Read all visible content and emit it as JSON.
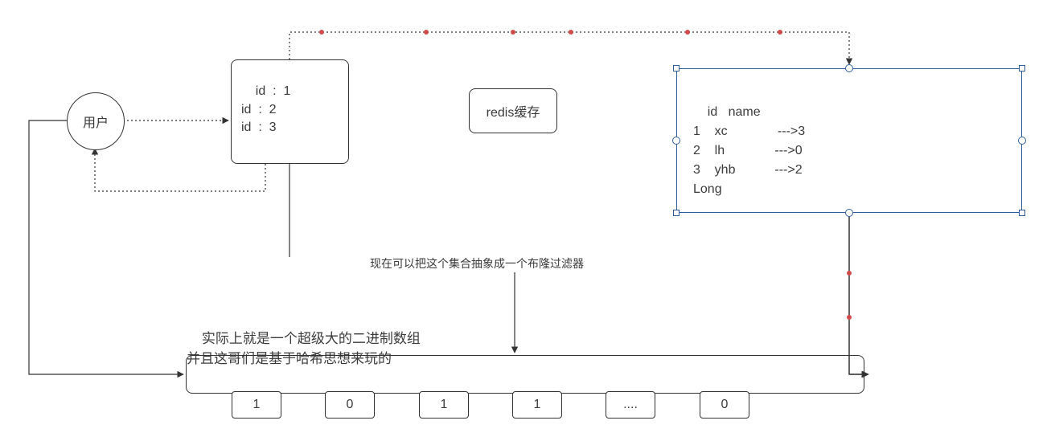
{
  "user": {
    "label": "用户"
  },
  "id_box": {
    "text": "id  :  1\nid  :  2\nid  :  3"
  },
  "redis": {
    "label": "redis缓存"
  },
  "db": {
    "text": "id   name\n1    xc              --->3\n2    lh              --->0\n3    yhb           --->2\nLong"
  },
  "annotation_top": "现在可以把这个集合抽象成一个布隆过滤器",
  "annotation_left": "实际上就是一个超级大的二进制数组\n并且这哥们是基于哈希思想来玩的",
  "cells": [
    "1",
    "0",
    "1",
    "1",
    "....",
    "0"
  ],
  "colors": {
    "selection": "#2f5e9e",
    "dot": "#d24b4b"
  }
}
